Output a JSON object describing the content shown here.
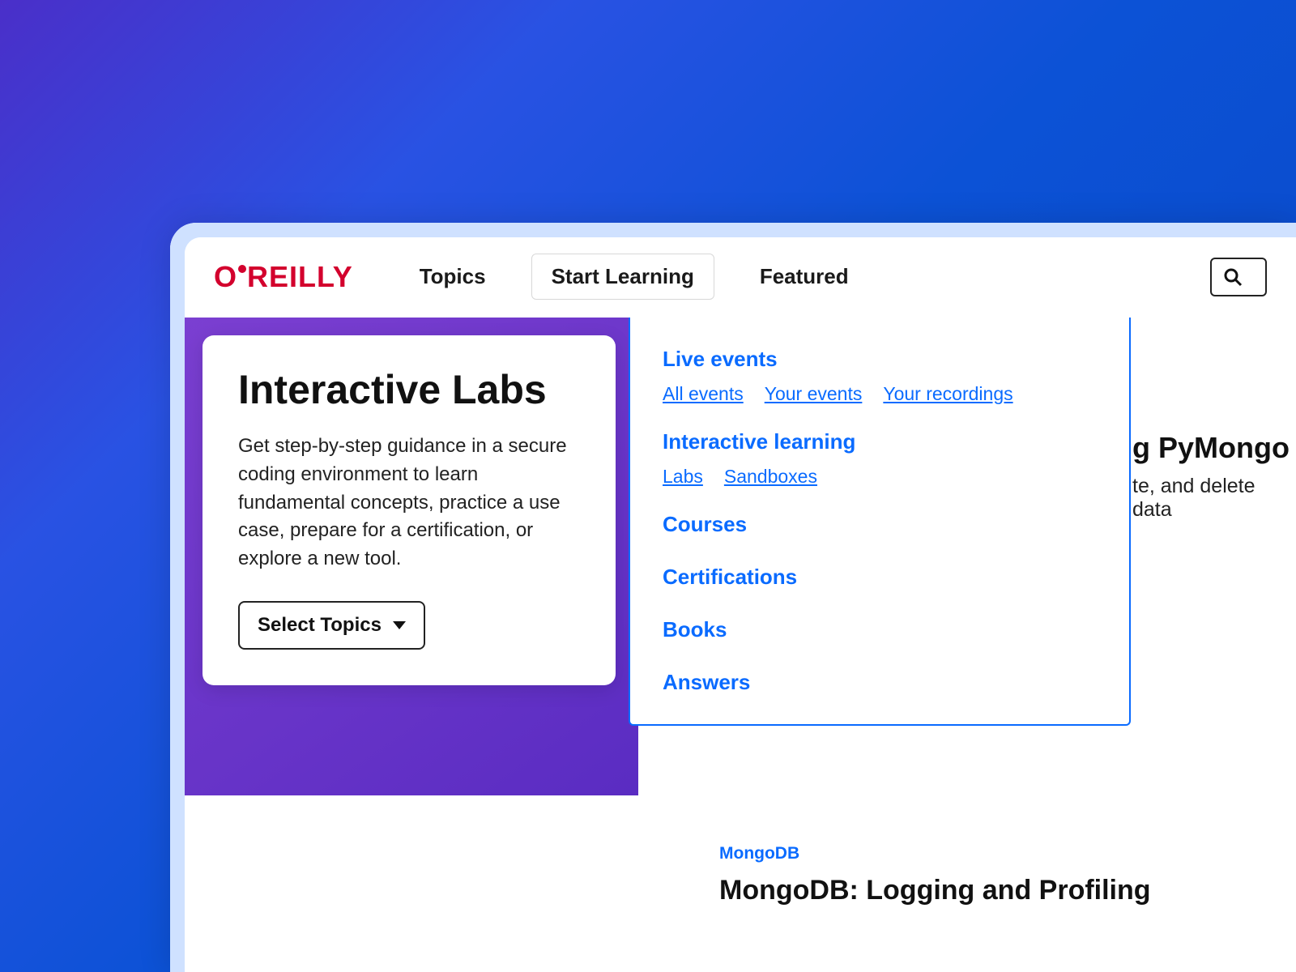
{
  "logo": {
    "text_a": "O",
    "text_b": "REILLY"
  },
  "nav": {
    "topics": "Topics",
    "start_learning": "Start Learning",
    "featured": "Featured"
  },
  "card": {
    "title": "Interactive Labs",
    "body": "Get step-by-step guidance in a secure coding environment to learn fundamental concepts, practice a use case, prepare for a certification, or explore a new tool.",
    "select_label": "Select Topics"
  },
  "dropdown": {
    "live_events": {
      "title": "Live events",
      "links": [
        "All events",
        "Your events",
        "Your recordings"
      ]
    },
    "interactive_learning": {
      "title": "Interactive learning",
      "links": [
        "Labs",
        "Sandboxes"
      ]
    },
    "courses": "Courses",
    "certifications": "Certifications",
    "books": "Books",
    "answers": "Answers"
  },
  "peek1": {
    "title_fragment": "g PyMongo",
    "body_fragment": "te, and delete data"
  },
  "peek2": {
    "tag": "MongoDB",
    "title": "MongoDB: Logging and Profiling"
  }
}
